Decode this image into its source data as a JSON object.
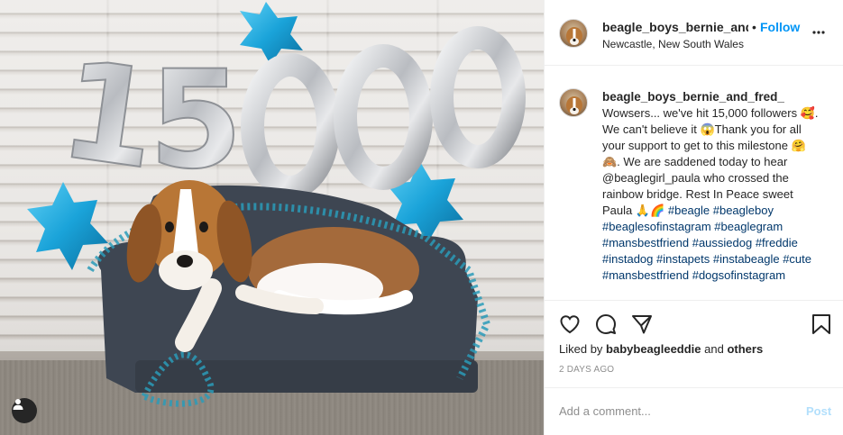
{
  "post": {
    "username": "beagle_boys_bernie_and_fred_",
    "follow_label": "Follow",
    "separator": "•",
    "location": "Newcastle, New South Wales",
    "caption_username": "beagle_boys_bernie_and_fred_",
    "caption_text": "Wowsers... we've hit 15,000 followers 🥰. We can't believe it 😱Thank you for all your support to get to this milestone 🤗🙈. We are saddened today to hear @beaglegirl_paula who crossed the rainbow bridge. Rest In Peace sweet Paula 🙏🌈",
    "hashtags": "#beagle #beagleboy #beaglesofinstagram #beaglegram #mansbestfriend #aussiedog #freddie #instadog #instapets #instabeagle #cute #mansbestfriend #dogsofinstagram"
  },
  "photo": {
    "balloon_text": "15000",
    "balloon_color": "#c9ccd0",
    "star_color": "#1aa3d9"
  },
  "engagement": {
    "liked_by_prefix": "Liked by ",
    "liked_by_user": "babybeagleeddie",
    "liked_by_middle": " and ",
    "liked_by_others": "others",
    "date": "2 DAYS AGO"
  },
  "comment": {
    "placeholder": "Add a comment...",
    "post_label": "Post"
  },
  "icons": {
    "like": "heart-icon",
    "comment": "comment-icon",
    "share": "paper-plane-icon",
    "save": "bookmark-icon",
    "more": "more-options-icon",
    "tags": "user-tag-icon"
  },
  "colors": {
    "link": "#0095f6",
    "hashtag": "#00376b",
    "muted": "#8e8e8e",
    "post_disabled": "#b2dffc"
  }
}
